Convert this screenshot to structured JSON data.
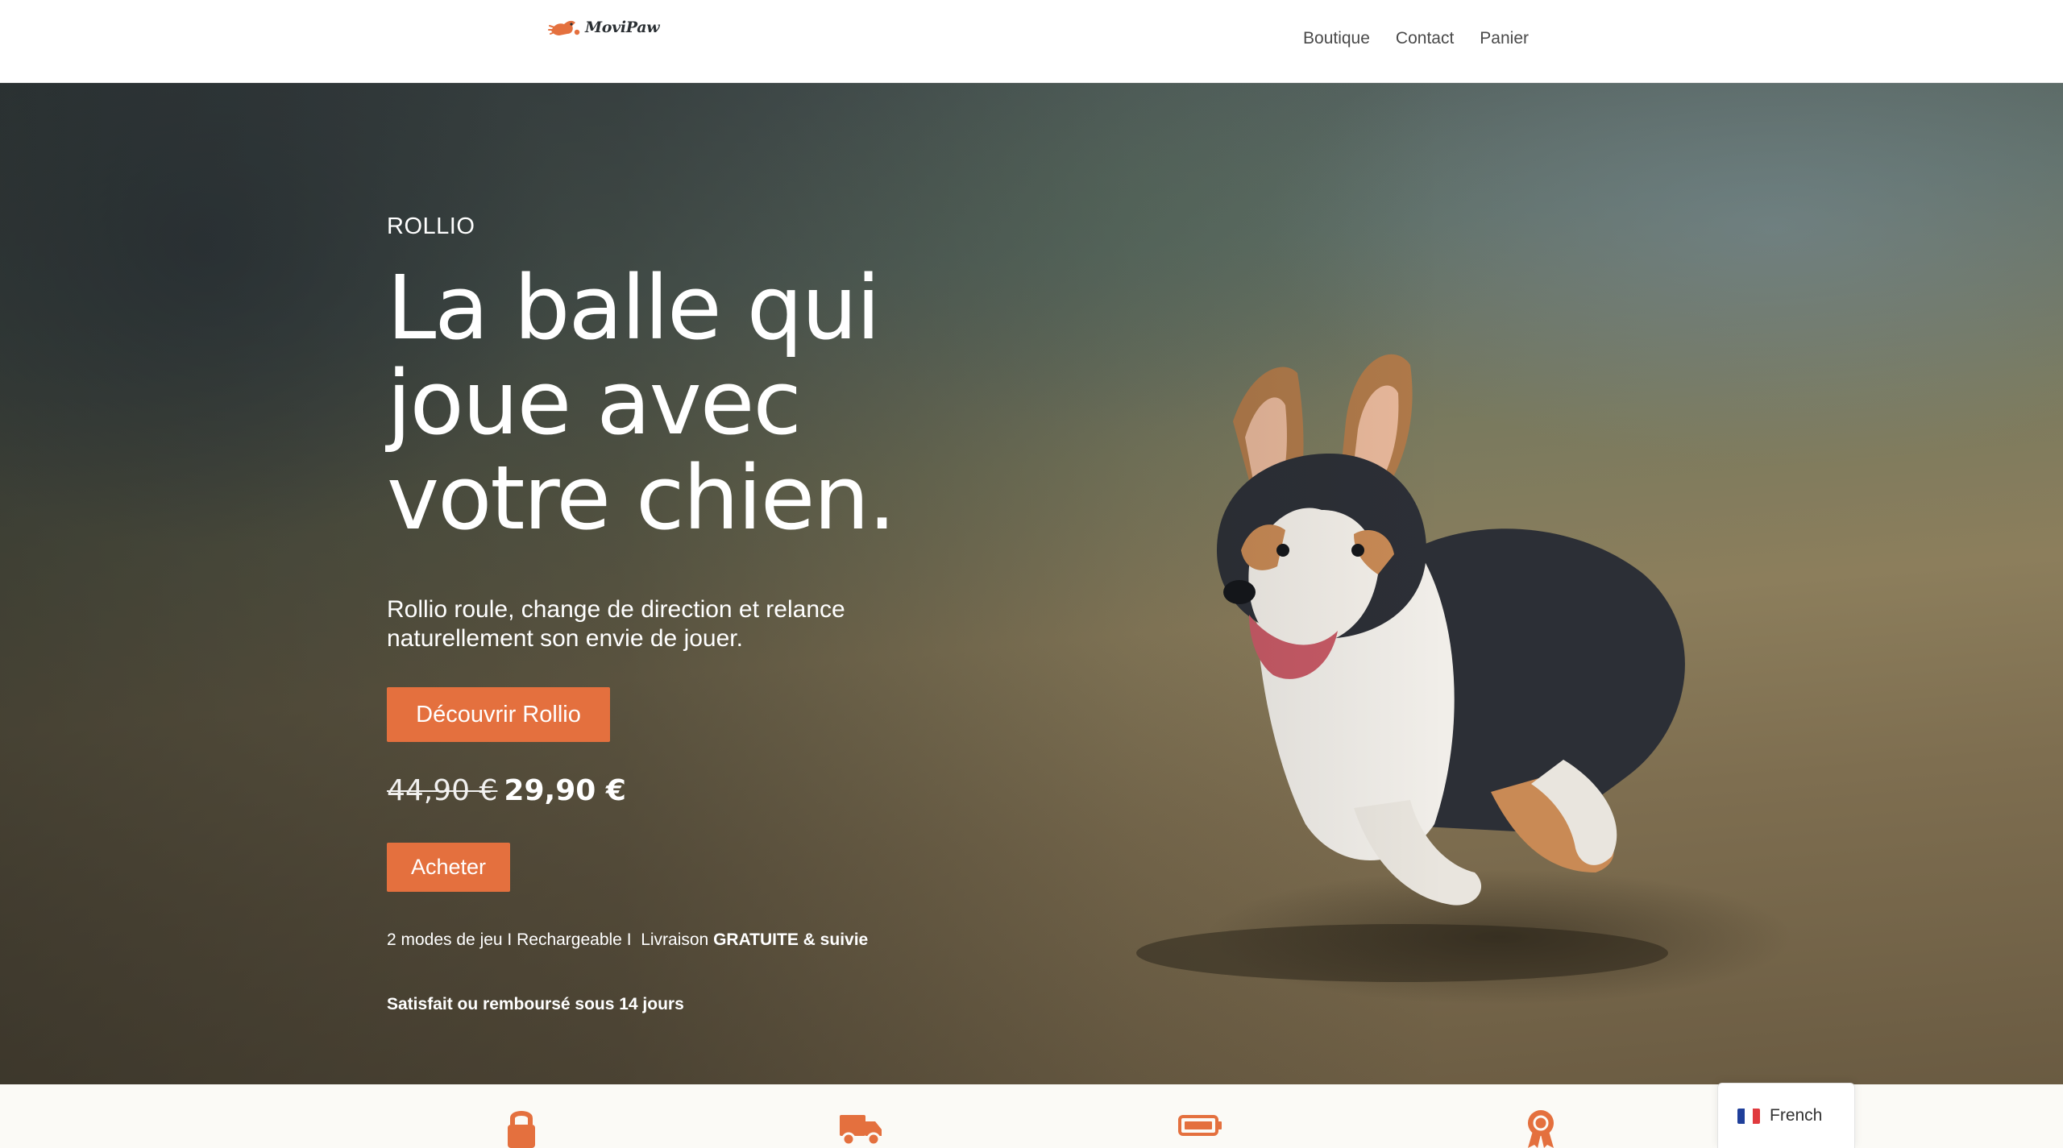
{
  "header": {
    "logo_text": "MoviPaw",
    "nav": [
      {
        "label": "Boutique"
      },
      {
        "label": "Contact"
      },
      {
        "label": "Panier"
      }
    ]
  },
  "hero": {
    "eyebrow": "ROLLIO",
    "headline": "La balle qui joue avec votre chien.",
    "subheading": "Rollio roule, change de direction et relance naturellement son envie de jouer.",
    "discover_button": "Découvrir Rollio",
    "price_old": "44,90 €",
    "price_new": "29,90 €",
    "buy_button": "Acheter",
    "features_text": "2 modes de jeu I Rechargeable I  Livraison ",
    "features_bold": "GRATUITE & suivie",
    "guarantee": "Satisfait ou remboursé sous 14 jours"
  },
  "benefits": {
    "icons": [
      "lock-icon",
      "delivery-truck-icon",
      "battery-icon",
      "award-ribbon-icon"
    ]
  },
  "language_switcher": {
    "label": "French",
    "flag_colors": [
      "#1f3f9a",
      "#ffffff",
      "#e03a3e"
    ]
  },
  "colors": {
    "accent": "#e4703e",
    "hero_text": "#ffffff",
    "nav_text": "#4a4a4a"
  }
}
